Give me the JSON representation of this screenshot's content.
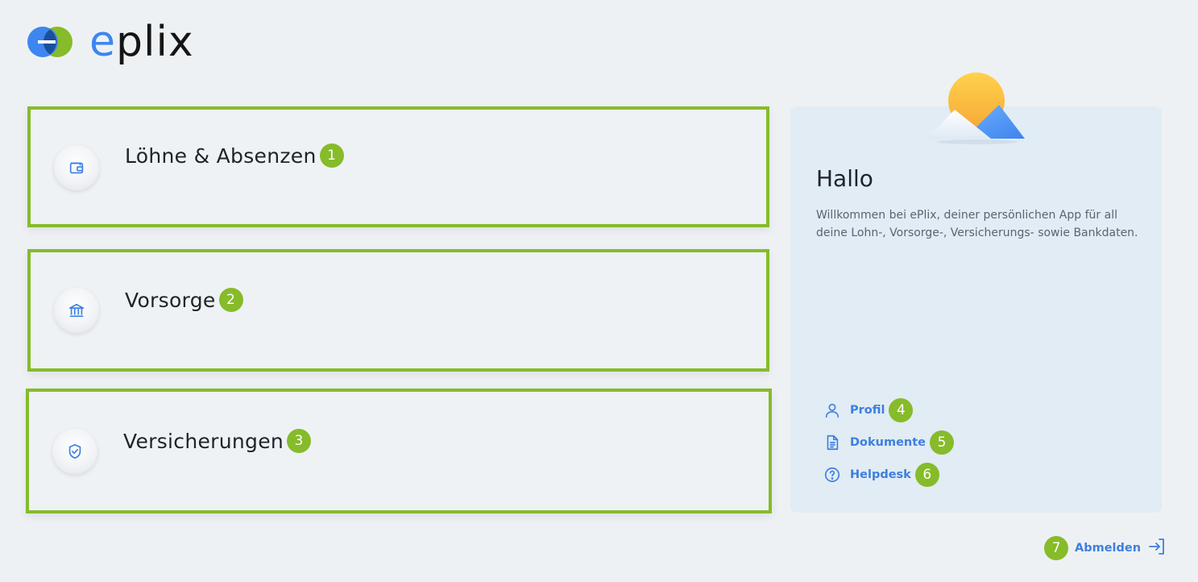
{
  "brand": {
    "name_accent": "e",
    "name_rest": "plix",
    "logo_colors": {
      "blue": "#3d86f0",
      "green": "#86bb2a"
    }
  },
  "tiles": [
    {
      "title": "Löhne & Absenzen",
      "badge": "1",
      "icon": "wallet-icon"
    },
    {
      "title": "Vorsorge",
      "badge": "2",
      "icon": "bank-icon"
    },
    {
      "title": "Versicherungen",
      "badge": "3",
      "icon": "shield-check-icon"
    }
  ],
  "welcome": {
    "title": "Hallo",
    "text": "Willkommen bei ePlix, deiner persönlichen App für all deine Lohn-, Vorsorge-, Versicherungs- sowie Bankdaten."
  },
  "links": [
    {
      "label": "Profil",
      "badge": "4",
      "icon": "user-icon"
    },
    {
      "label": "Dokumente",
      "badge": "5",
      "icon": "document-icon"
    },
    {
      "label": "Helpdesk",
      "badge": "6",
      "icon": "help-icon"
    }
  ],
  "logout": {
    "label": "Abmelden",
    "badge": "7",
    "icon": "logout-icon"
  },
  "colors": {
    "accent": "#3d7fe0",
    "highlight": "#86bb2a",
    "background": "#eef1f4",
    "panel": "#e1ecf4"
  }
}
